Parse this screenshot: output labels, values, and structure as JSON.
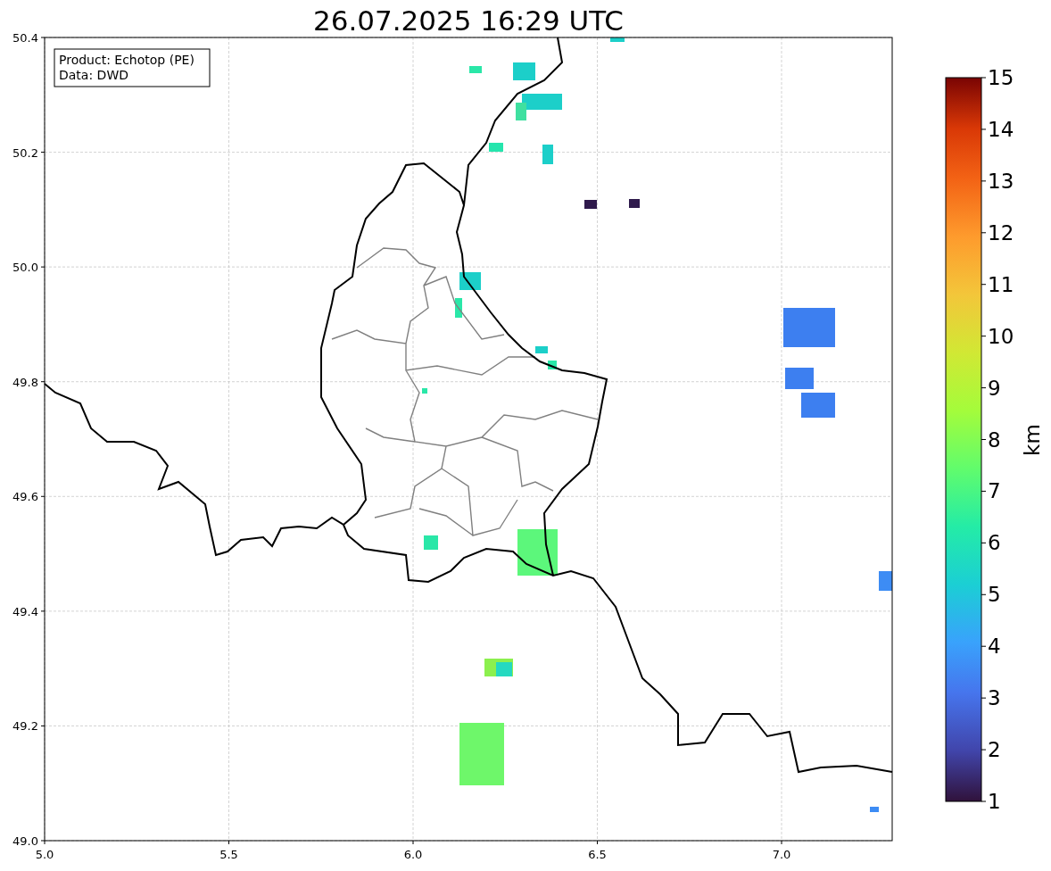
{
  "title": "26.07.2025 16:29 UTC",
  "info_box": {
    "lines": [
      "Product: Echotop (PE)",
      "Data: DWD"
    ]
  },
  "map": {
    "xticks": [
      "5.0",
      "5.5",
      "6.0",
      "6.5",
      "7.0"
    ],
    "yticks": [
      "50.4",
      "50.2",
      "50.0",
      "49.8",
      "49.6",
      "49.4",
      "49.2",
      "49.0"
    ]
  },
  "colorbar": {
    "label": "km",
    "ticks": [
      "15",
      "14",
      "13",
      "12",
      "11",
      "10",
      "9",
      "8",
      "7",
      "6",
      "5",
      "4",
      "3",
      "2",
      "1"
    ]
  }
}
